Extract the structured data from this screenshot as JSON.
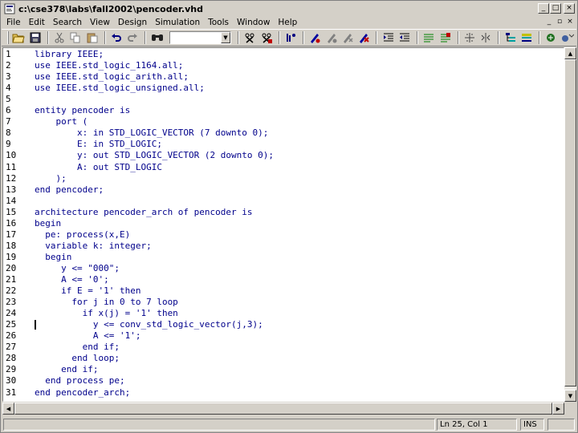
{
  "window": {
    "title": "c:\\cse378\\labs\\fall2002\\pencoder.vhd",
    "min_label": "_",
    "max_label": "□",
    "close_label": "×"
  },
  "menu": {
    "items": [
      "File",
      "Edit",
      "Search",
      "View",
      "Design",
      "Simulation",
      "Tools",
      "Window",
      "Help"
    ],
    "mdi_min": "_",
    "mdi_restore": "▫",
    "mdi_close": "×"
  },
  "toolbar": {
    "icons": [
      "open-icon",
      "save-icon",
      "cut-icon",
      "copy-icon",
      "paste-icon",
      "undo-icon",
      "redo-icon",
      "find-icon",
      "search-combo",
      "compile-icon",
      "compile-all-icon",
      "analyze-icon",
      "set-breakpoint-icon",
      "toggle-breakpoint-icon",
      "clear-breakpoint-icon",
      "delete-breakpoint-icon",
      "indent-icon",
      "outdent-icon",
      "comment-icon",
      "uncomment-icon",
      "split-icon",
      "merge-icon",
      "hierarchy-icon",
      "waveform-icon",
      "run-icon",
      "step-icon"
    ],
    "search_value": ""
  },
  "editor": {
    "lines": [
      {
        "num": "1",
        "text": "library IEEE;"
      },
      {
        "num": "2",
        "text": "use IEEE.std_logic_1164.all;"
      },
      {
        "num": "3",
        "text": "use IEEE.std_logic_arith.all;"
      },
      {
        "num": "4",
        "text": "use IEEE.std_logic_unsigned.all;"
      },
      {
        "num": "5",
        "text": ""
      },
      {
        "num": "6",
        "text": "entity pencoder is"
      },
      {
        "num": "7",
        "text": "    port ("
      },
      {
        "num": "8",
        "text": "        x: in STD_LOGIC_VECTOR (7 downto 0);"
      },
      {
        "num": "9",
        "text": "        E: in STD_LOGIC;"
      },
      {
        "num": "10",
        "text": "        y: out STD_LOGIC_VECTOR (2 downto 0);"
      },
      {
        "num": "11",
        "text": "        A: out STD_LOGIC"
      },
      {
        "num": "12",
        "text": "    );"
      },
      {
        "num": "13",
        "text": "end pencoder;"
      },
      {
        "num": "14",
        "text": ""
      },
      {
        "num": "15",
        "text": "architecture pencoder_arch of pencoder is"
      },
      {
        "num": "16",
        "text": "begin"
      },
      {
        "num": "17",
        "text": "  pe: process(x,E)"
      },
      {
        "num": "18",
        "text": "  variable k: integer;"
      },
      {
        "num": "19",
        "text": "  begin"
      },
      {
        "num": "20",
        "text": "     y <= \"000\";"
      },
      {
        "num": "21",
        "text": "     A <= '0';"
      },
      {
        "num": "22",
        "text": "     if E = '1' then"
      },
      {
        "num": "23",
        "text": "       for j in 0 to 7 loop"
      },
      {
        "num": "24",
        "text": "         if x(j) = '1' then"
      },
      {
        "num": "25",
        "text": "           y <= conv_std_logic_vector(j,3);"
      },
      {
        "num": "26",
        "text": "           A <= '1';"
      },
      {
        "num": "27",
        "text": "         end if;"
      },
      {
        "num": "28",
        "text": "       end loop;"
      },
      {
        "num": "29",
        "text": "     end if;"
      },
      {
        "num": "30",
        "text": "  end process pe;"
      },
      {
        "num": "31",
        "text": "end pencoder_arch;"
      }
    ]
  },
  "status": {
    "position": "Ln 25, Col 1",
    "mode": "INS"
  }
}
